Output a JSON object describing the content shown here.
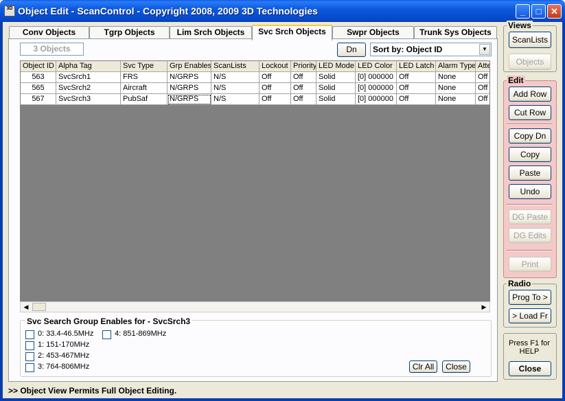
{
  "window": {
    "title": "Object Edit - ScanControl - Copyright 2008, 2009 3D Technologies",
    "icon_text": "3D"
  },
  "tabs": [
    {
      "label": "Conv Objects"
    },
    {
      "label": "Tgrp Objects"
    },
    {
      "label": "Lim Srch Objects"
    },
    {
      "label": "Svc Srch Objects"
    },
    {
      "label": "Swpr Objects"
    },
    {
      "label": "Trunk Sys Objects"
    }
  ],
  "toolbar": {
    "object_count": "3 Objects",
    "dn_label": "Dn",
    "sort_value": "Sort by: Object ID"
  },
  "grid": {
    "columns": [
      "Object ID",
      "Alpha Tag",
      "Svc Type",
      "Grp Enables",
      "ScanLists",
      "Lockout",
      "Priority",
      "LED Mode",
      "LED Color",
      "LED Latch",
      "Alarm Type",
      "Atte"
    ],
    "rows": [
      [
        "563",
        "SvcSrch1",
        "FRS",
        "N/GRPS",
        "N/S",
        "Off",
        "Off",
        "Solid",
        "[0] 000000",
        "Off",
        "None",
        "Off"
      ],
      [
        "565",
        "SvcSrch2",
        "Aircraft",
        "N/GRPS",
        "N/S",
        "Off",
        "Off",
        "Solid",
        "[0] 000000",
        "Off",
        "None",
        "Off"
      ],
      [
        "567",
        "SvcSrch3",
        "PubSaf",
        "N/GRPS",
        "N/S",
        "Off",
        "Off",
        "Solid",
        "[0] 000000",
        "Off",
        "None",
        "Off"
      ]
    ]
  },
  "group_enables": {
    "title": "Svc Search Group Enables for - SvcSrch3",
    "items": [
      {
        "label": "0: 33.4-46.5MHz",
        "checked": false
      },
      {
        "label": "1: 151-170MHz",
        "checked": false
      },
      {
        "label": "2: 453-467MHz",
        "checked": false
      },
      {
        "label": "3: 764-806MHz",
        "checked": false
      },
      {
        "label": "4: 851-869MHz",
        "checked": false
      }
    ],
    "clr_all_label": "Clr All",
    "close_label": "Close"
  },
  "status_text": ">> Object View Permits Full Object Editing.",
  "sidebar": {
    "views_label": "Views",
    "scanlists_label": "ScanLists",
    "objects_label": "Objects",
    "edit_label": "Edit",
    "add_row_label": "Add Row",
    "cut_row_label": "Cut Row",
    "copy_dn_label": "Copy Dn",
    "copy_label": "Copy",
    "paste_label": "Paste",
    "undo_label": "Undo",
    "dg_paste_label": "DG Paste",
    "dg_edits_label": "DG Edits",
    "print_label": "Print",
    "radio_label": "Radio",
    "prog_to_label": "Prog To >",
    "load_fr_label": "> Load Fr",
    "help_text": "Press F1 for HELP",
    "close_label": "Close"
  }
}
